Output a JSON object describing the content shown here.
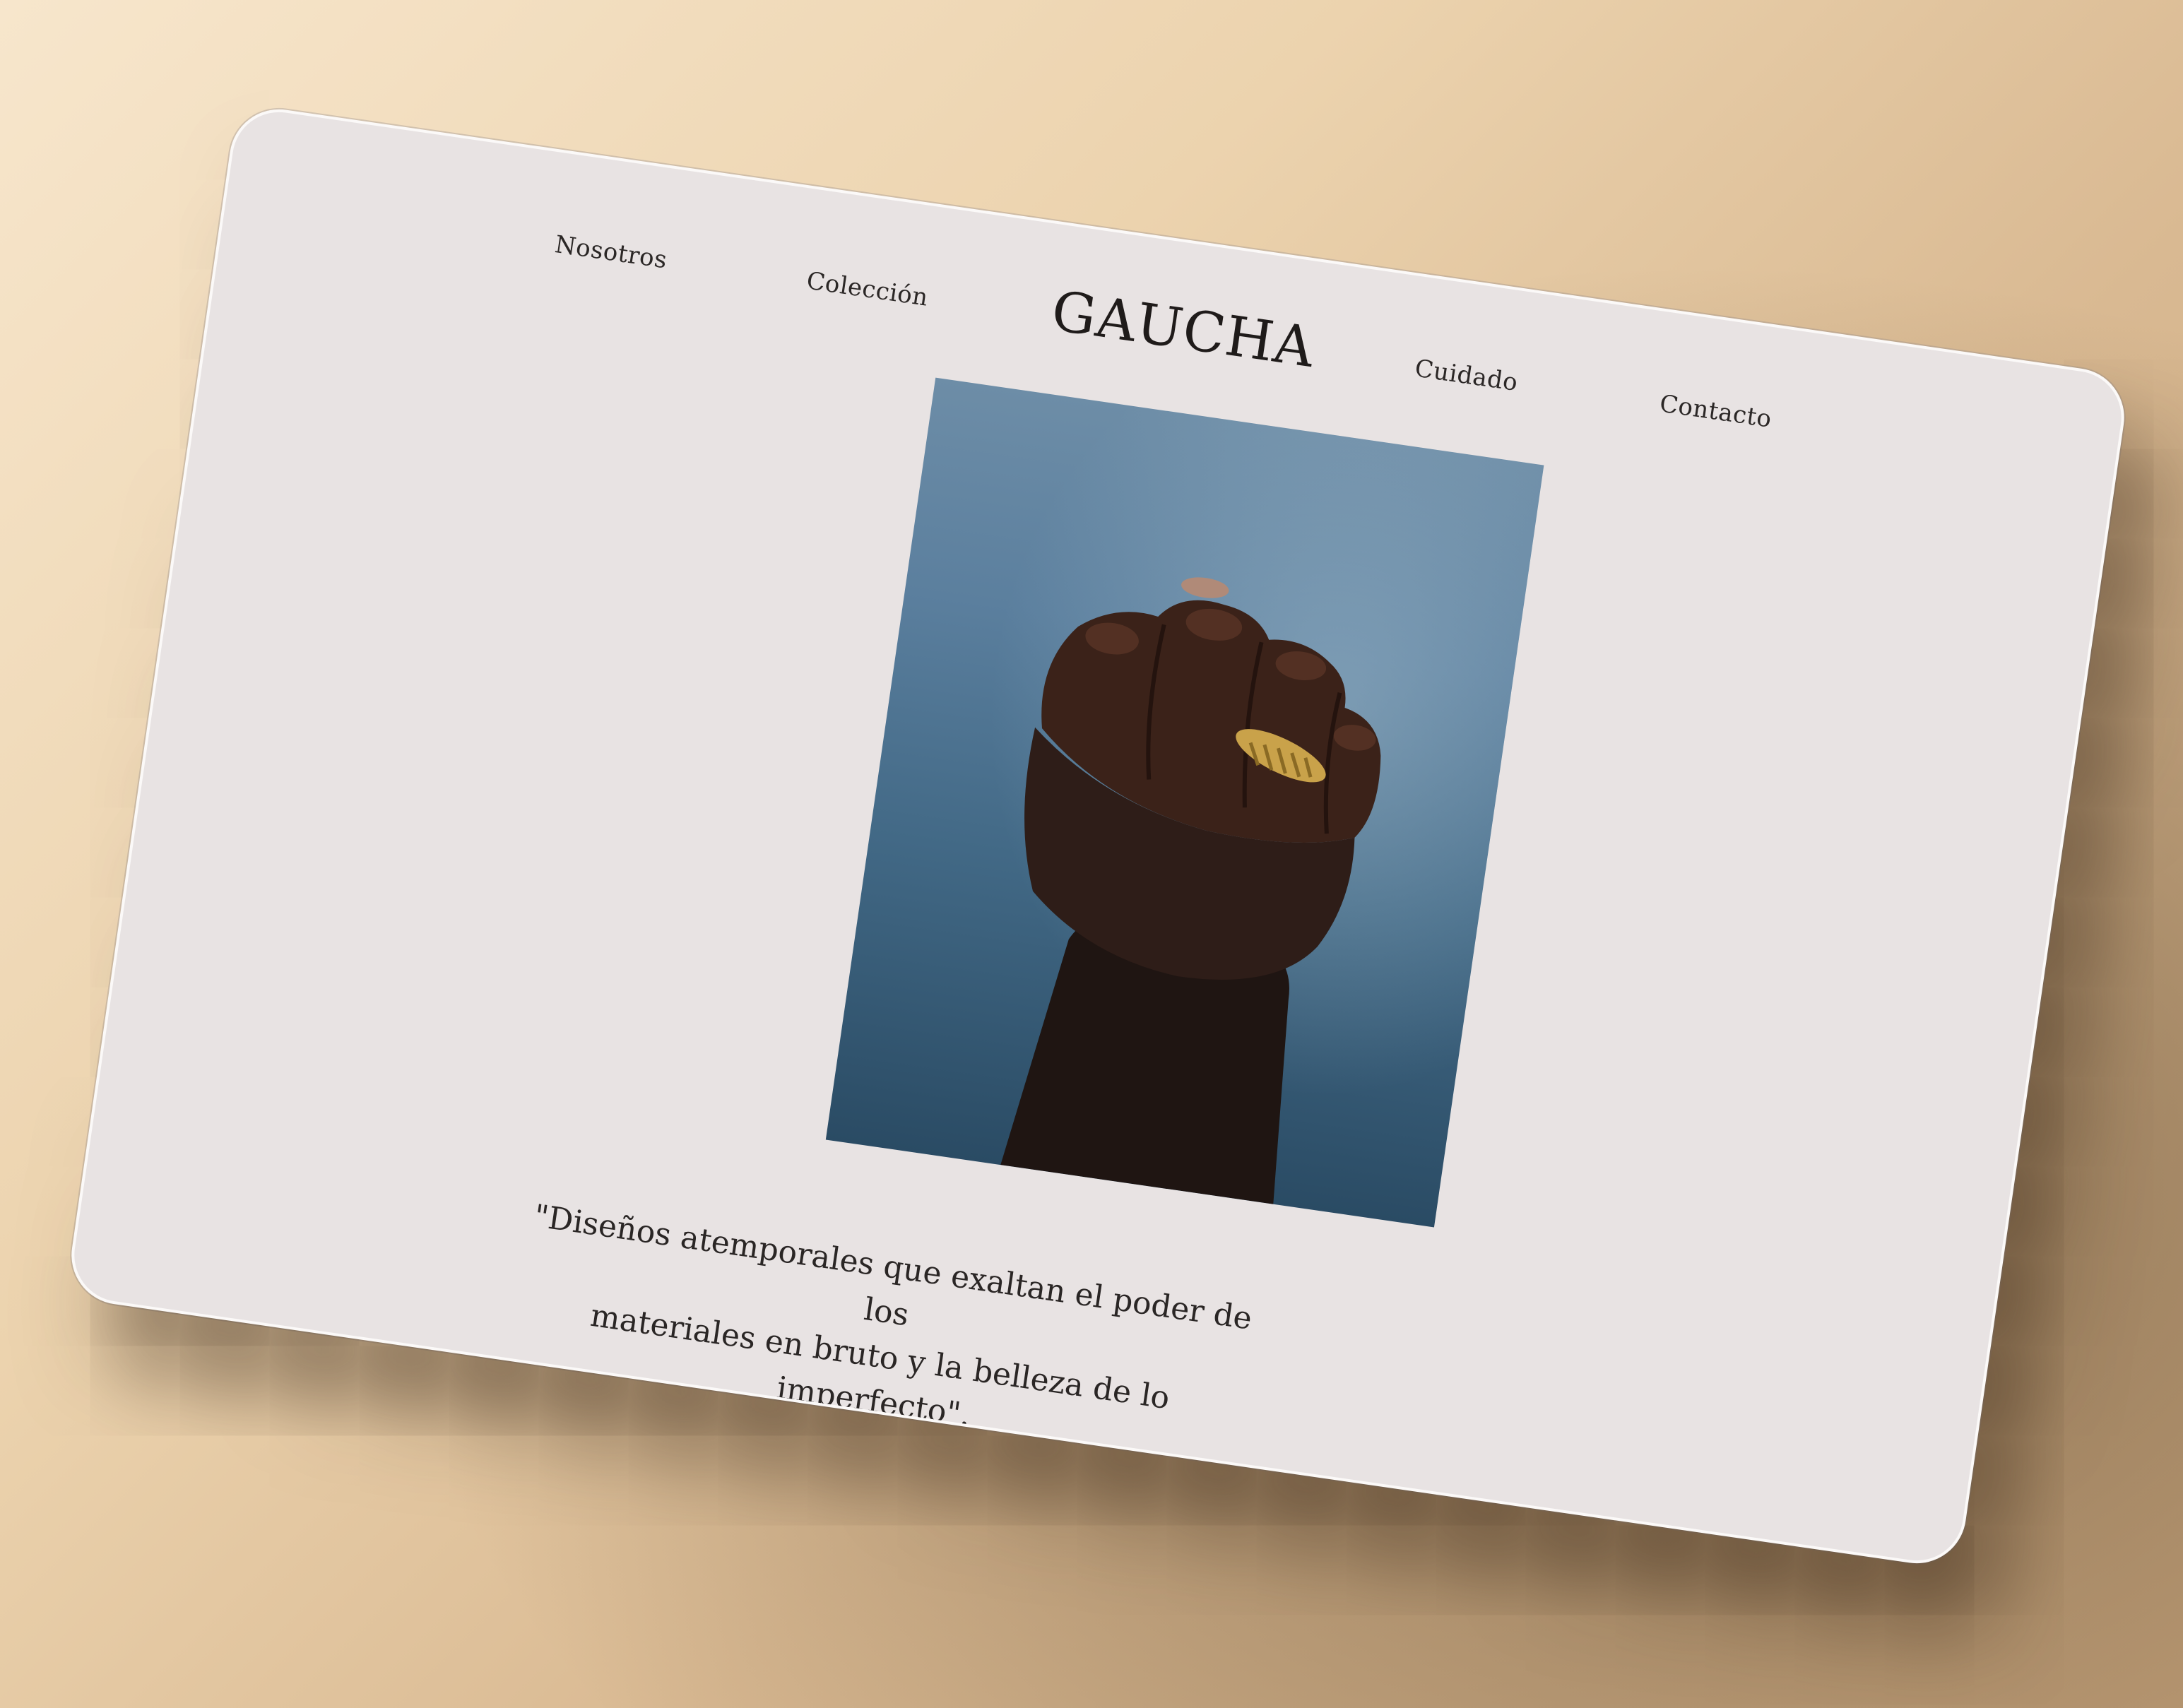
{
  "nav": {
    "left": [
      "Nosotros",
      "Colección"
    ],
    "right": [
      "Cuidado",
      "Contacto"
    ]
  },
  "brand": "GAUCHA",
  "hero_image": {
    "alt": "",
    "colors": {
      "background": "#5b7f9e",
      "skin": "#3a2219",
      "sleeve": "#2b1b17",
      "ring": "#c9a24a"
    }
  },
  "quote": {
    "line1": "\"Diseños atemporales que exaltan el poder de los",
    "line2": "materiales en bruto y la belleza de lo imperfecto\"."
  },
  "colors": {
    "page_background": "#e8e3e3",
    "text": "#2b2726"
  }
}
